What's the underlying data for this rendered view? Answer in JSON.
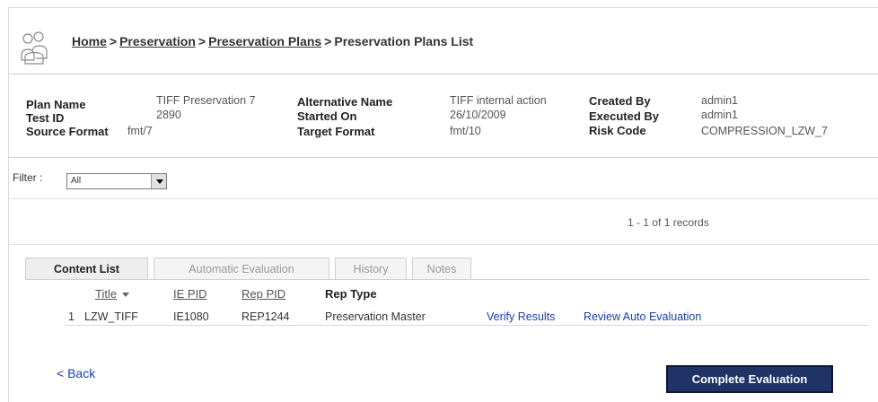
{
  "header": {
    "icon": "people-icon",
    "breadcrumb": {
      "home": "Home",
      "preservation": "Preservation",
      "plans": "Preservation Plans",
      "current": "Preservation Plans List",
      "separator": ">"
    }
  },
  "plan_info": {
    "plan_name_label": "Plan Name",
    "plan_name_value": "TIFF Preservation 7",
    "test_id_label": "Test ID",
    "test_id_value": "2890",
    "source_format_label": "Source Format",
    "source_format_value": "fmt/7",
    "alternative_name_label": "Alternative Name",
    "alternative_name_value": "TIFF internal action",
    "started_on_label": "Started On",
    "started_on_value": "26/10/2009",
    "target_format_label": "Target Format",
    "target_format_value": "fmt/10",
    "created_by_label": "Created By",
    "created_by_value": "admin1",
    "executed_by_label": "Executed By",
    "executed_by_value": "admin1",
    "risk_code_label": "Risk Code",
    "risk_code_value": "COMPRESSION_LZW_7"
  },
  "filter": {
    "label": "Filter :",
    "selected": "All"
  },
  "records": "1 - 1 of 1 records",
  "tabs": [
    {
      "label": "Content List",
      "active": true
    },
    {
      "label": "Automatic Evaluation",
      "active": false
    },
    {
      "label": "History",
      "active": false
    },
    {
      "label": "Notes",
      "active": false
    }
  ],
  "table": {
    "columns": {
      "title": "Title",
      "ie_pid": "IE PID",
      "rep_pid": "Rep PID",
      "rep_type": "Rep Type"
    },
    "rows": [
      {
        "index": "1",
        "title": "LZW_TIFF",
        "ie_pid": "IE1080",
        "rep_pid": "REP1244",
        "rep_type": "Preservation Master",
        "action1": "Verify Results",
        "action2": "Review Auto Evaluation"
      }
    ]
  },
  "footer": {
    "back_label": "< Back",
    "complete_label": "Complete Evaluation"
  },
  "colors": {
    "link": "#1a3fa8",
    "button_bg": "#1f3366"
  }
}
